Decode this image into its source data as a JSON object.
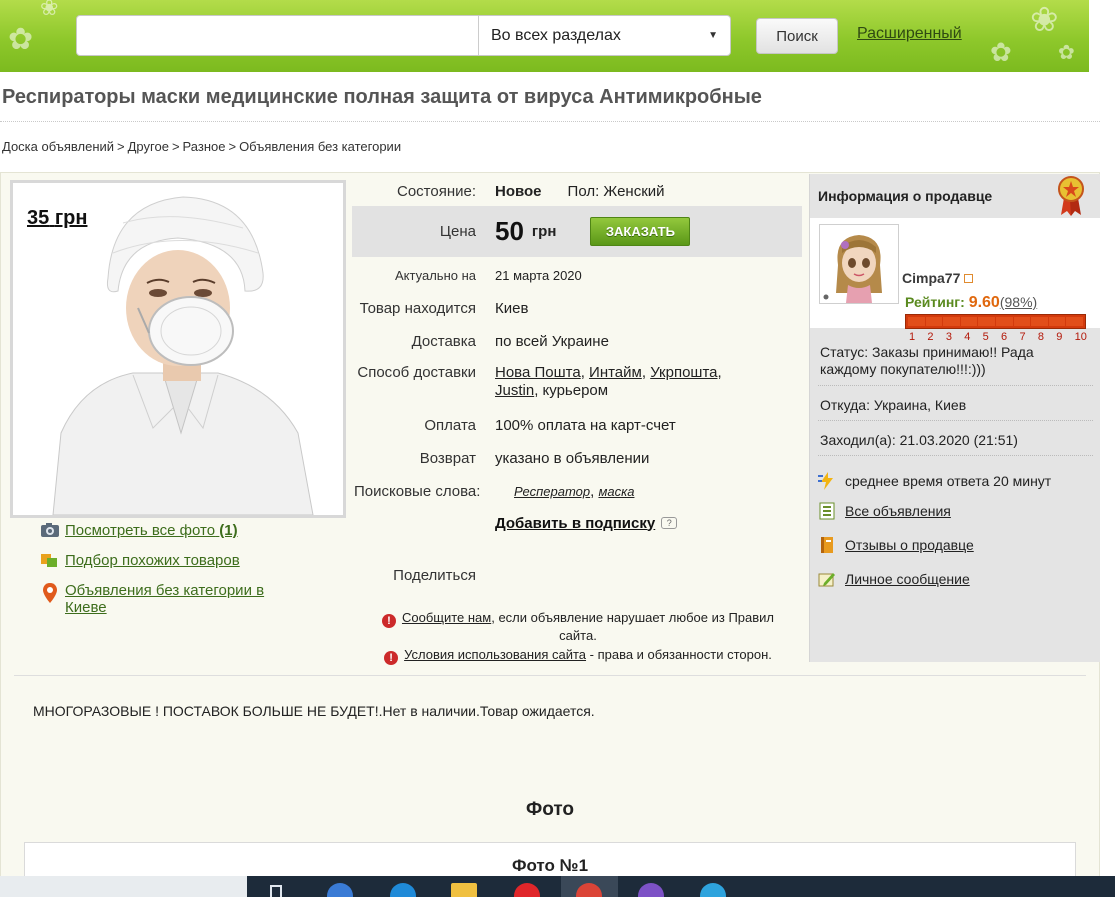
{
  "header": {
    "search_placeholder": "",
    "scope": "Во всех разделах",
    "search_button": "Поиск",
    "advanced_link": "Расширенный"
  },
  "title": "Респираторы маски медицинские полная защита от вируса Антимикробные",
  "breadcrumbs": [
    "Доска объявлений",
    "Другое",
    "Разное",
    "Объявления без категории"
  ],
  "photo": {
    "price": "35",
    "price_unit": "грн"
  },
  "left_links": {
    "all_photos": "Посмотреть все фото",
    "all_photos_count": "(1)",
    "similar": "Подбор похожих товаров",
    "location_line1": "Объявления без категории в",
    "location_line2": "Киеве"
  },
  "details": {
    "condition_label": "Состояние:",
    "condition_value": "Новое",
    "gender": "Пол: Женский",
    "price_label": "Цена",
    "price_value": "50",
    "price_currency": "грн",
    "order_button": "ЗАКАЗАТЬ",
    "actual_label": "Актуально на",
    "actual_value": "21 марта 2020",
    "location_label": "Товар находится",
    "location_value": "Киев",
    "delivery_label": "Доставка",
    "delivery_value": "по всей Украине",
    "delivery_method_label": "Способ доставки",
    "delivery_methods": [
      "Нова Пошта",
      "Интайм",
      "Укрпошта",
      "Justin"
    ],
    "delivery_courier": "курьером",
    "payment_label": "Оплата",
    "payment_value": "100% оплата на карт-счет",
    "return_label": "Возврат",
    "return_value": "указано в объявлении",
    "keywords_label": "Поисковые слова:",
    "keywords": [
      "Респератор",
      "маска"
    ],
    "subscribe": "Добавить в подписку",
    "share_label": "Поделиться",
    "report_link": "Сообщите нам",
    "report_text": ", если объявление нарушает любое из Правил",
    "report_text2": "сайта.",
    "terms_link": "Условия использования сайта",
    "terms_text": " - права и обязанности сторон."
  },
  "seller": {
    "header": "Информация о продавце",
    "name": "Cimpa77",
    "rating_label": "Рейтинг:",
    "rating_value": "9.60",
    "rating_pct": "(98%)",
    "rating_level": 0.96,
    "rating_scale": [
      "1",
      "2",
      "3",
      "4",
      "5",
      "6",
      "7",
      "8",
      "9",
      "10"
    ],
    "status": "Статус: Заказы принимаю!! Рада каждому покупателю!!!:)))",
    "from": "Откуда: Украина, Киев",
    "last_visit": "Заходил(а): 21.03.2020 (21:51)",
    "response_time": "среднее время ответа 20 минут",
    "all_ads": "Все объявления",
    "reviews": "Отзывы о продавце",
    "message": "Личное сообщение"
  },
  "description": "МНОГОРАЗОВЫЕ ! ПОСТАВОК БОЛЬШЕ НЕ БУДЕТ!.Нет в наличии.Товар ожидается.",
  "photos_title": "Фото",
  "photo_card_title": "Фото №1",
  "colors": {
    "header_green": "#8ec82b",
    "link_green": "#3d6d1c",
    "order_green": "#5a9717",
    "rating_orange": "#e0680e"
  }
}
